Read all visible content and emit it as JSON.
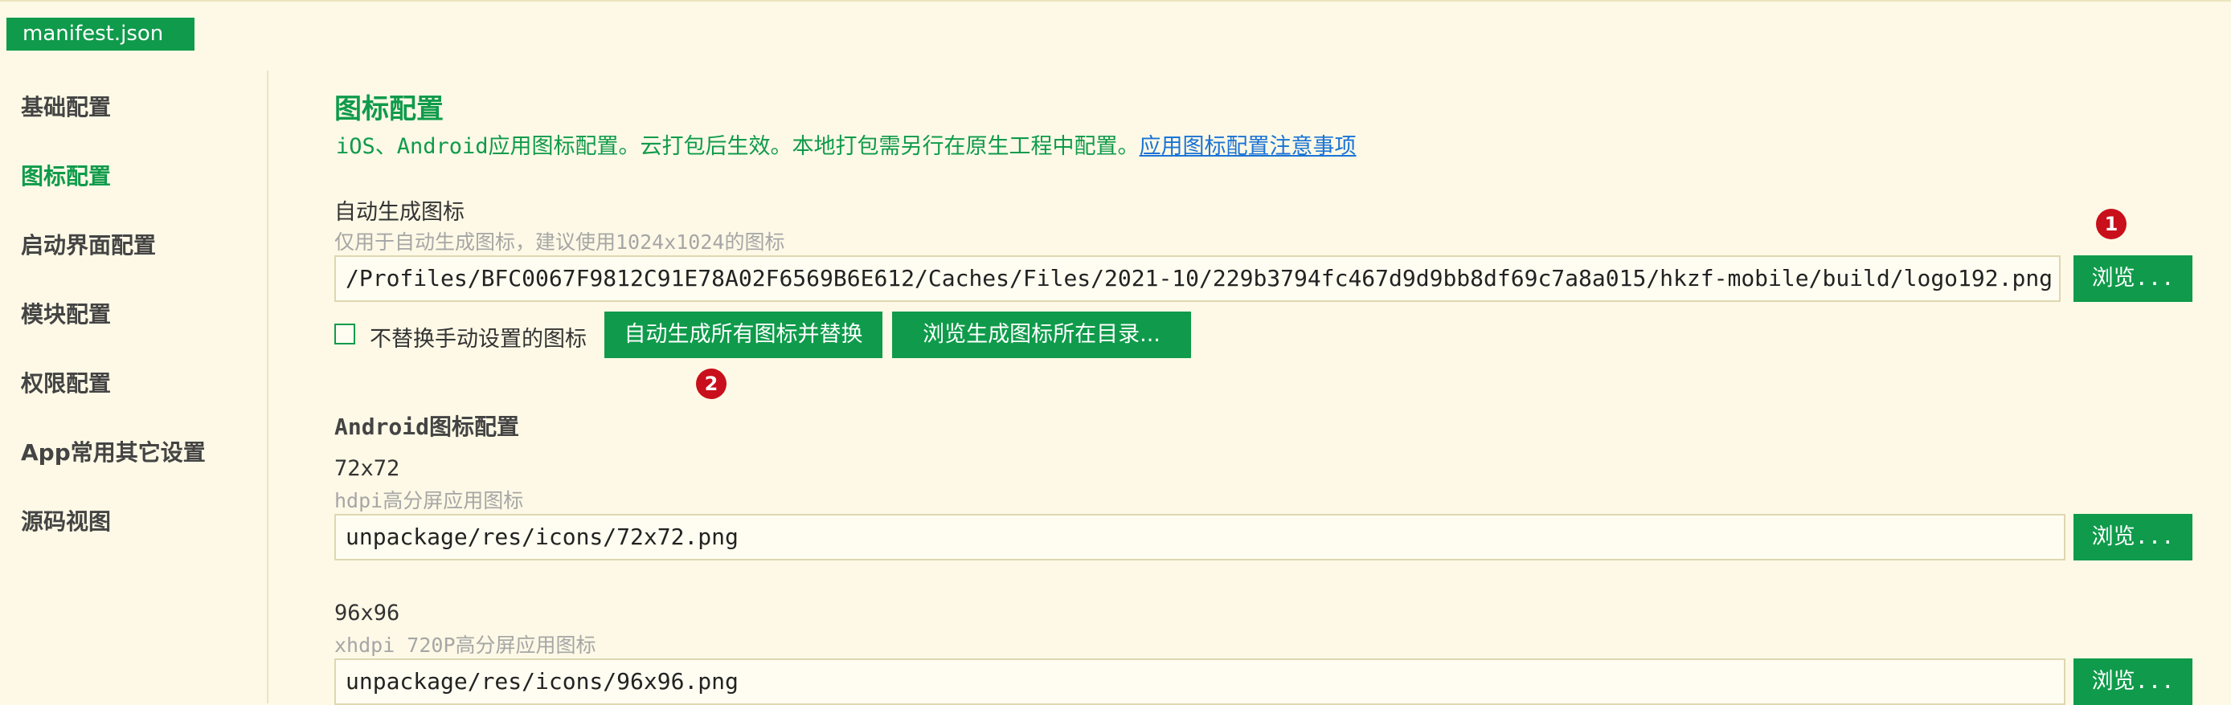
{
  "tab": {
    "label": "manifest.json"
  },
  "sidebar": {
    "items": [
      {
        "label": "基础配置"
      },
      {
        "label": "图标配置"
      },
      {
        "label": "启动界面配置"
      },
      {
        "label": "模块配置"
      },
      {
        "label": "权限配置"
      },
      {
        "label": "App常用其它设置"
      },
      {
        "label": "源码视图"
      }
    ],
    "active_index": 1
  },
  "main": {
    "title": "图标配置",
    "description": "iOS、Android应用图标配置。云打包后生效。本地打包需另行在原生工程中配置。",
    "description_link": "应用图标配置注意事项",
    "auto": {
      "label": "自动生成图标",
      "hint": "仅用于自动生成图标，建议使用1024x1024的图标",
      "path": "/Profiles/BFC0067F9812C91E78A02F6569B6E612/Caches/Files/2021-10/229b3794fc467d9d9bb8df69c7a8a015/hkzf-mobile/build/logo192.png",
      "browse_label": "浏览...",
      "checkbox_label": "不替换手动设置的图标",
      "checkbox_checked": false,
      "generate_label": "自动生成所有图标并替换",
      "open_dir_label": "浏览生成图标所在目录...",
      "badge1": "1",
      "badge2": "2"
    },
    "android": {
      "section_title": "Android图标配置",
      "icons": [
        {
          "size": "72x72",
          "hint": "hdpi高分屏应用图标",
          "path": "unpackage/res/icons/72x72.png",
          "browse_label": "浏览..."
        },
        {
          "size": "96x96",
          "hint": "xhdpi 720P高分屏应用图标",
          "path": "unpackage/res/icons/96x96.png",
          "browse_label": "浏览..."
        }
      ]
    }
  },
  "colors": {
    "accent": "#0f9b4b",
    "background": "#fdf9e6",
    "link": "#1a73d6",
    "badge": "#c80f1b"
  }
}
